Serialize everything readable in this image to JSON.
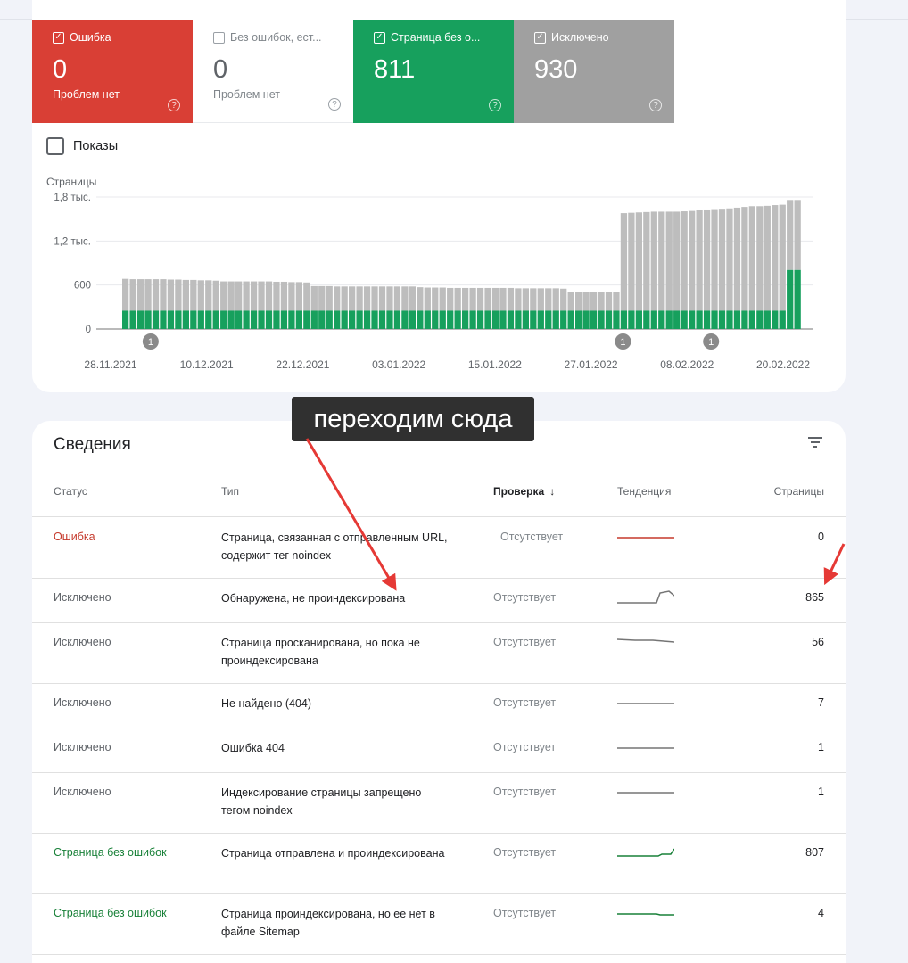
{
  "tiles": [
    {
      "label": "Ошибка",
      "value": "0",
      "sub": "Проблем нет",
      "checked": true
    },
    {
      "label": "Без ошибок, ест...",
      "value": "0",
      "sub": "Проблем нет",
      "checked": false
    },
    {
      "label": "Страница без о...",
      "value": "811",
      "sub": "",
      "checked": true
    },
    {
      "label": "Исключено",
      "value": "930",
      "sub": "",
      "checked": true
    }
  ],
  "impressions_label": "Показы",
  "chart_data": {
    "type": "bar",
    "stacked": true,
    "ylabel": "Страницы",
    "y_ticks": [
      "1,8 тыс.",
      "1,2 тыс.",
      "600",
      "0"
    ],
    "y_tick_values": [
      1800,
      1200,
      600,
      0
    ],
    "ylim": [
      0,
      1800
    ],
    "x_tick_labels": [
      "28.11.2021",
      "10.12.2021",
      "22.12.2021",
      "03.01.2022",
      "15.01.2022",
      "27.01.2022",
      "08.02.2022",
      "20.02.2022"
    ],
    "grid": true,
    "colors": {
      "valid": "#17a05d",
      "excluded": "#bdbdbd",
      "error": "#d93f35"
    },
    "series": [
      {
        "name": "Страница без ошибок",
        "values": [
          250,
          250,
          250,
          250,
          250,
          250,
          250,
          250,
          250,
          250,
          250,
          250,
          250,
          250,
          250,
          250,
          250,
          250,
          250,
          250,
          250,
          250,
          250,
          250,
          250,
          250,
          250,
          250,
          250,
          250,
          250,
          250,
          250,
          250,
          250,
          250,
          250,
          250,
          250,
          250,
          250,
          250,
          250,
          250,
          250,
          250,
          250,
          250,
          250,
          250,
          250,
          250,
          250,
          250,
          250,
          250,
          250,
          250,
          250,
          250,
          250,
          250,
          250,
          250,
          250,
          250,
          250,
          250,
          250,
          250,
          250,
          250,
          250,
          250,
          250,
          250,
          250,
          250,
          250,
          250,
          250,
          250,
          250,
          250,
          250,
          250,
          250,
          250,
          805,
          805
        ]
      },
      {
        "name": "Исключено",
        "values": [
          435,
          430,
          430,
          430,
          430,
          430,
          425,
          425,
          420,
          420,
          415,
          415,
          410,
          400,
          400,
          400,
          400,
          400,
          400,
          400,
          395,
          395,
          390,
          390,
          385,
          335,
          335,
          335,
          330,
          330,
          330,
          330,
          330,
          330,
          330,
          330,
          330,
          330,
          330,
          320,
          315,
          315,
          315,
          310,
          310,
          310,
          310,
          310,
          310,
          310,
          310,
          310,
          305,
          305,
          305,
          305,
          305,
          305,
          300,
          260,
          260,
          260,
          260,
          260,
          260,
          260,
          1330,
          1335,
          1340,
          1345,
          1350,
          1350,
          1350,
          1350,
          1355,
          1360,
          1375,
          1380,
          1385,
          1390,
          1395,
          1405,
          1415,
          1425,
          1425,
          1430,
          1440,
          1445,
          955,
          955
        ]
      }
    ],
    "markers": [
      {
        "x": "03.12.2021",
        "label": "1"
      },
      {
        "x": "31.01.2022",
        "label": "1"
      },
      {
        "x": "11.02.2022",
        "label": "1"
      }
    ]
  },
  "details": {
    "title": "Сведения",
    "columns": {
      "status": "Статус",
      "type": "Тип",
      "check": "Проверка",
      "trend": "Тенденция",
      "pages": "Страницы"
    },
    "rows": [
      {
        "status": "Ошибка",
        "type": "Страница, связанная с отправленным URL, содержит тег noindex",
        "check": "Отсутствует",
        "pages": "0"
      },
      {
        "status": "Исключено",
        "type": "Обнаружена, не проиндексирована",
        "check": "Отсутствует",
        "pages": "865"
      },
      {
        "status": "Исключено",
        "type": "Страница просканирована, но пока не проиндексирована",
        "check": "Отсутствует",
        "pages": "56"
      },
      {
        "status": "Исключено",
        "type": "Не найдено (404)",
        "check": "Отсутствует",
        "pages": "7"
      },
      {
        "status": "Исключено",
        "type": "Ошибка 404",
        "check": "Отсутствует",
        "pages": "1"
      },
      {
        "status": "Исключено",
        "type": "Индексирование страницы запрещено тегом noindex",
        "check": "Отсутствует",
        "pages": "1"
      },
      {
        "status": "Страница без ошибок",
        "type": "Страница отправлена и проиндексирована",
        "check": "Отсутствует",
        "pages": "807"
      },
      {
        "status": "Страница без ошибок",
        "type": "Страница проиндексирована, но ее нет в файле Sitemap",
        "check": "Отсутствует",
        "pages": "4"
      }
    ]
  },
  "callout": "переходим сюда"
}
